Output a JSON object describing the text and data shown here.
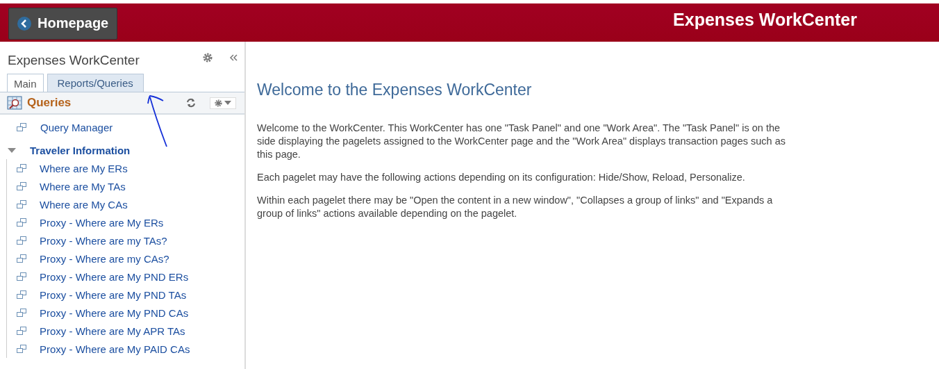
{
  "header": {
    "back_button": "Homepage",
    "title": "Expenses WorkCenter"
  },
  "sidebar": {
    "title": "Expenses WorkCenter",
    "tabs": [
      {
        "label": "Main",
        "selected": false
      },
      {
        "label": "Reports/Queries",
        "selected": true
      }
    ],
    "pagelet": {
      "title": "Queries",
      "links": [
        {
          "label": "Query Manager"
        }
      ],
      "groups": [
        {
          "title": "Traveler Information",
          "expanded": true,
          "links": [
            {
              "label": "Where are My ERs"
            },
            {
              "label": "Where are My TAs"
            },
            {
              "label": "Where are My CAs"
            },
            {
              "label": "Proxy - Where are My ERs"
            },
            {
              "label": "Proxy - Where are my TAs?"
            },
            {
              "label": "Proxy - Where are my CAs?"
            },
            {
              "label": "Proxy - Where are My PND ERs"
            },
            {
              "label": "Proxy - Where are My PND TAs"
            },
            {
              "label": "Proxy - Where are My PND CAs"
            },
            {
              "label": "Proxy - Where are My APR TAs"
            },
            {
              "label": "Proxy - Where are My PAID CAs"
            }
          ]
        }
      ]
    }
  },
  "work_area": {
    "heading": "Welcome to the Expenses WorkCenter",
    "paragraphs": [
      "Welcome to the WorkCenter. This WorkCenter has one \"Task Panel\" and one \"Work Area\". The \"Task Panel\" is on the side displaying the pagelets assigned to the WorkCenter page and the \"Work Area\" displays transaction pages such as this page.",
      "Each pagelet may have the following actions depending on its configuration: Hide/Show, Reload, Personalize.",
      "Within each pagelet there may be \"Open the content in a new window\", \"Collapses a group of links\" and \"Expands a group of links\" actions available depending on the pagelet."
    ]
  }
}
